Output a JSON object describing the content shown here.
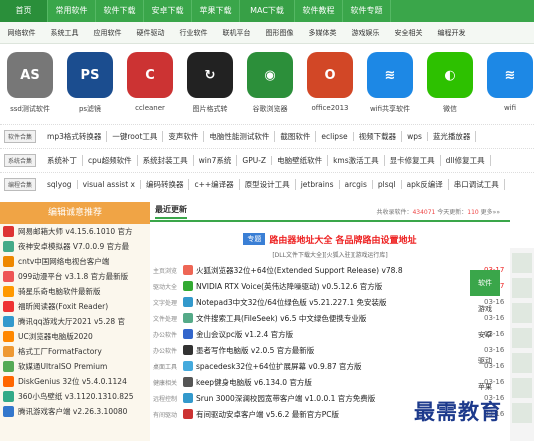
{
  "nav": [
    "首页",
    "常用软件",
    "软件下载",
    "安卓下载",
    "苹果下载",
    "MAC下载",
    "软件教程",
    "软件专题"
  ],
  "subnav": [
    "网络软件",
    "系统工具",
    "应用软件",
    "硬件驱动",
    "行业软件",
    "联机平台",
    "图形图像",
    "多媒体类",
    "游戏娱乐",
    "安全相关",
    "编程开发"
  ],
  "apps": [
    {
      "label": "ssd测试软件",
      "color": "#777777",
      "glyph": "AS"
    },
    {
      "label": "ps滤镜",
      "color": "#1b4d8f",
      "glyph": "PS"
    },
    {
      "label": "ccleaner",
      "color": "#cc3333",
      "glyph": "C"
    },
    {
      "label": "图片格式转",
      "color": "#222222",
      "glyph": "↻"
    },
    {
      "label": "谷歌浏览器",
      "color": "#2c8f3a",
      "glyph": "◉"
    },
    {
      "label": "office2013",
      "color": "#d24726",
      "glyph": "O"
    },
    {
      "label": "wifi共享软件",
      "color": "#1d88e5",
      "glyph": "≋"
    },
    {
      "label": "微信",
      "color": "#2dc100",
      "glyph": "◐"
    },
    {
      "label": "wifi",
      "color": "#1d88e5",
      "glyph": "≋"
    }
  ],
  "tagrows": [
    {
      "tag": "软件合集",
      "items": [
        "mp3格式转换器",
        "一键root工具",
        "变声软件",
        "电脑性能测试软件",
        "截图软件",
        "eclipse",
        "视频下载器",
        "wps",
        "蓝光播放器"
      ]
    },
    {
      "tag": "系统合集",
      "items": [
        "系统补丁",
        "cpu超频软件",
        "系统封装工具",
        "win7系统",
        "GPU-Z",
        "电脑壁纸软件",
        "kms激活工具",
        "显卡修复工具",
        "dll修复工具"
      ]
    },
    {
      "tag": "编程合集",
      "items": [
        "sqlyog",
        "visual assist x",
        "编码转换器",
        "c++编译器",
        "原型设计工具",
        "jetbrains",
        "arcgis",
        "plsql",
        "apk反编译",
        "串口调试工具"
      ]
    }
  ],
  "left": {
    "title": "编辑诚意推荐",
    "items": [
      {
        "t": "网易邮箱大师 v4.15.6.1010 官方",
        "c": "#d33"
      },
      {
        "t": "夜神安卓模拟器 V7.0.0.9 官方最",
        "c": "#4a8"
      },
      {
        "t": "cntv中国网络电视台客户端",
        "c": "#e80"
      },
      {
        "t": "099动漫平台 v3.1.8 官方最新版",
        "c": "#e55"
      },
      {
        "t": "骑星乐奇电脑软件最新版",
        "c": "#f90"
      },
      {
        "t": "福昕阅读器(Foxit Reader)",
        "c": "#e33"
      },
      {
        "t": "腾讯qq游戏大厅2021 v5.28 官",
        "c": "#39c"
      },
      {
        "t": "UC浏览器电脑版2020",
        "c": "#f80"
      },
      {
        "t": "格式工厂FormatFactory",
        "c": "#e93"
      },
      {
        "t": "软媒通UltraISO Premium",
        "c": "#5a5"
      },
      {
        "t": "DiskGenius 32位 v5.4.0.1124",
        "c": "#f60"
      },
      {
        "t": "360小鸟壁纸 v3.1120.1310.825",
        "c": "#3a8"
      },
      {
        "t": "腾讯游戏客户端 v2.26.3.10080",
        "c": "#37c"
      }
    ]
  },
  "center": {
    "title": "最近更新",
    "stats_prefix": "共收录软件：",
    "stats_total": "434071",
    "stats_mid": "  今天更新：",
    "stats_today": "110",
    "stats_more": "  更多»»",
    "banner_tag": "专题",
    "banner_main": "路由器地址大全 各品牌路由设置地址",
    "banner_sub": "[DLL文件下载大全][火狐入驻][游戏运行库]",
    "rows": [
      {
        "cat": "主页浏览",
        "name": "火狐浏览器32位+64位(Extended Support Release) v78.8",
        "date": "03-17",
        "red": true,
        "c": "#e65"
      },
      {
        "cat": "驱动大全",
        "name": "NVIDIA RTX Voice(英伟达降噪驱动) v0.5.12.6 官方版",
        "date": "03-17",
        "red": true,
        "c": "#3a3"
      },
      {
        "cat": "文字处理",
        "name": "Notepad3中文32位/64位绿色版 v5.21.227.1 免安装版",
        "date": "03-16",
        "red": false,
        "c": "#39c"
      },
      {
        "cat": "文件处理",
        "name": "文件搜索工具(FileSeek) v6.5 中文绿色便携专业版",
        "date": "03-16",
        "red": false,
        "c": "#5a8"
      },
      {
        "cat": "办公软件",
        "name": "金山会议pc版 v1.2.4 官方版",
        "date": "03-16",
        "red": false,
        "c": "#36c"
      },
      {
        "cat": "办公软件",
        "name": "墨者写作电脑版 v2.0.5 官方最新版",
        "date": "03-16",
        "red": false,
        "c": "#333"
      },
      {
        "cat": "桌面工具",
        "name": "spacedesk32位+64位扩展屏幕 v0.9.87 官方版",
        "date": "03-16",
        "red": false,
        "c": "#4ad"
      },
      {
        "cat": "健康相关",
        "name": "keep健身电脑版 v6.134.0 官方版",
        "date": "03-16",
        "red": false,
        "c": "#555"
      },
      {
        "cat": "远程控制",
        "name": "Srun 3000深澜校园宽带客户端 v1.0.0.1 官方免费版",
        "date": "03-16",
        "red": false,
        "c": "#39c"
      },
      {
        "cat": "有间驱动",
        "name": "有间驱动安卓客户端 v5.6.2 最新官方PC版",
        "date": "03-16",
        "red": false,
        "c": "#c33"
      }
    ]
  },
  "right_tabs": [
    "软件",
    "游戏",
    "安卓",
    "驱动",
    "苹果"
  ],
  "watermark": "最需教育"
}
